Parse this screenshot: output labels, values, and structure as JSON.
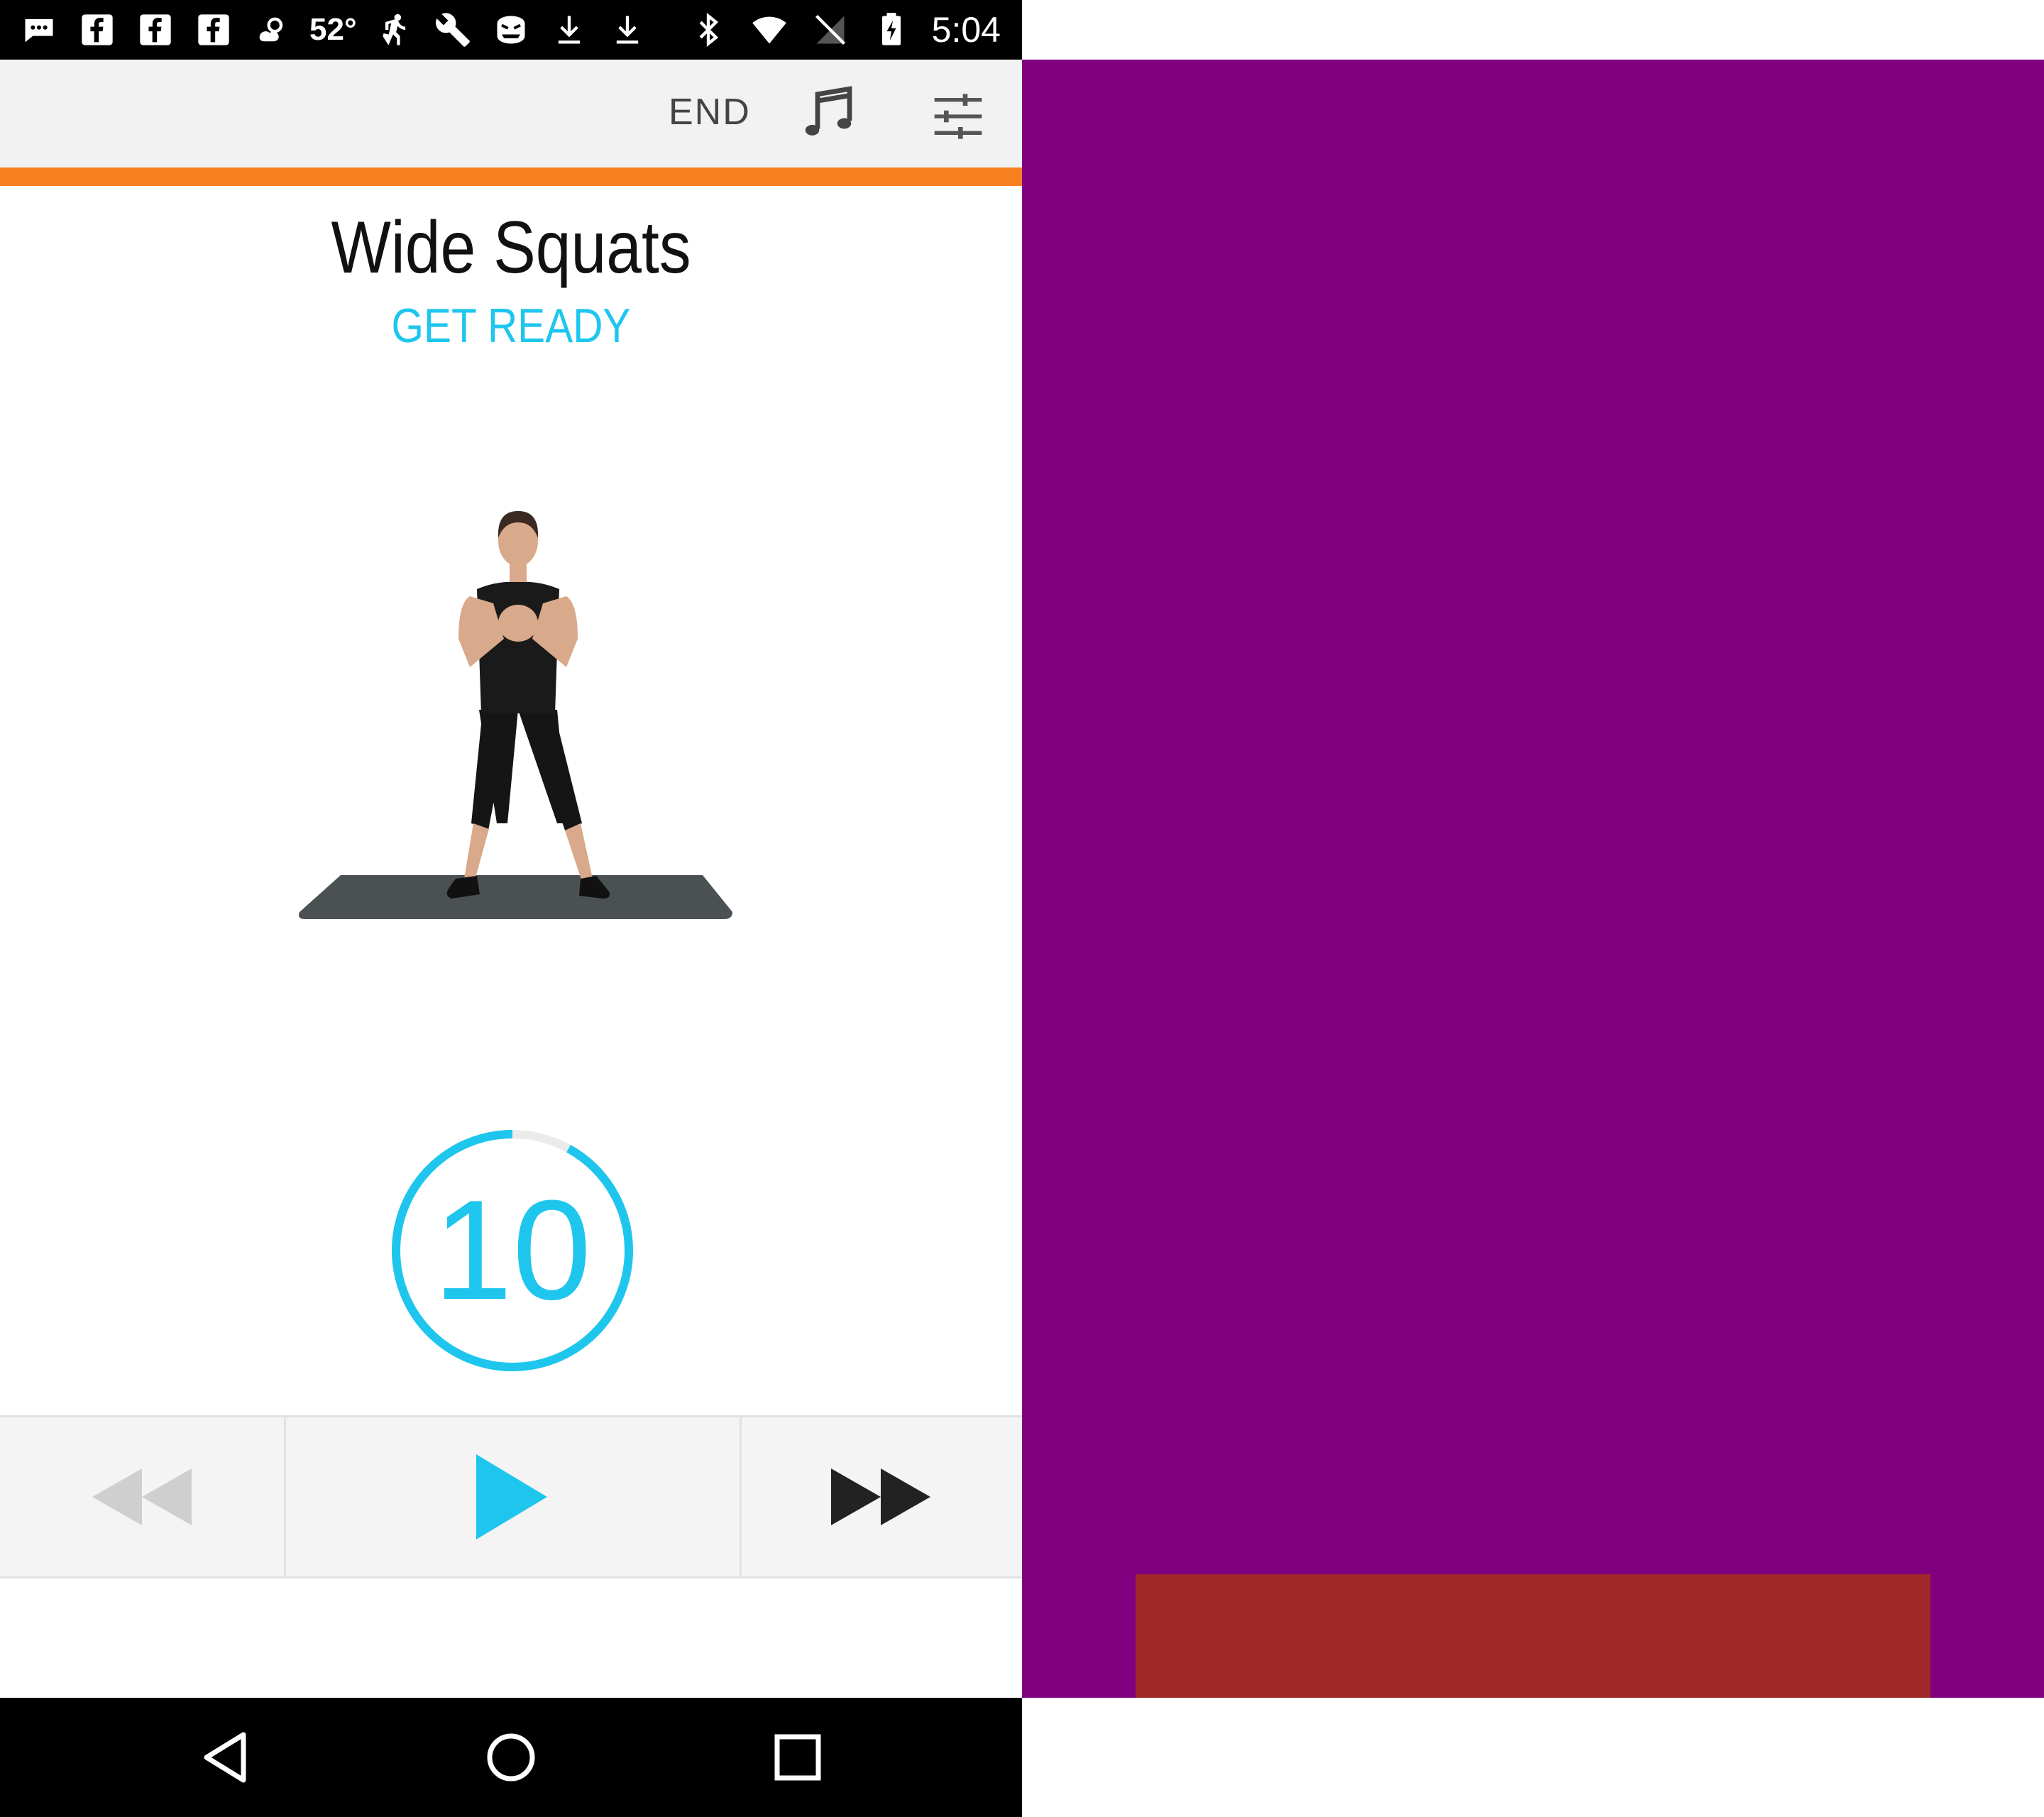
{
  "status_bar": {
    "temperature": "52°",
    "time": "5:04",
    "left_icons": [
      "message-icon",
      "facebook-icon",
      "facebook-icon",
      "facebook-icon",
      "weather-icon",
      "temperature",
      "running-icon",
      "wrench-icon",
      "monster-icon",
      "download-icon",
      "download-icon"
    ],
    "right_icons": [
      "bluetooth-icon",
      "wifi-icon",
      "no-signal-icon",
      "battery-charging-icon"
    ]
  },
  "toolbar": {
    "end_label": "END",
    "music_icon": "music-note-icon",
    "settings_icon": "sliders-icon"
  },
  "workout": {
    "exercise_name": "Wide Squats",
    "status": "GET READY",
    "countdown": "10",
    "countdown_progress": 0.92
  },
  "controls": {
    "rewind_icon": "rewind-icon",
    "play_icon": "play-icon",
    "fast_forward_icon": "fast-forward-icon"
  },
  "nav_bar": {
    "back_icon": "back-icon",
    "home_icon": "home-icon",
    "recents_icon": "recents-icon"
  },
  "colors": {
    "accent_blue": "#1ec6ee",
    "accent_orange": "#f7801f",
    "panel_purple": "#800080",
    "block_red": "#a12829"
  }
}
